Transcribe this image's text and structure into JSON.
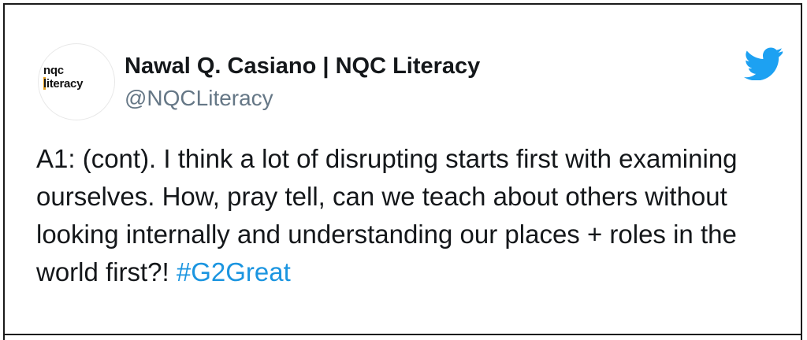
{
  "author": {
    "display_name": "Nawal Q. Casiano | NQC Literacy",
    "handle": "@NQCLiteracy",
    "avatar": {
      "line1": "nqc",
      "line2": "literacy",
      "accent_color": "#e8a01c"
    }
  },
  "tweet": {
    "text": "A1: (cont). I think a lot of disrupting starts first with examining ourselves. How, pray tell, can we teach about others without looking internally and understanding our places + roles in the world first?! ",
    "hashtag": "#G2Great"
  },
  "icons": {
    "brand": "twitter-bird-icon"
  },
  "colors": {
    "text": "#14171a",
    "handle": "#657786",
    "hashtag": "#1b95e0",
    "twitter_blue": "#1da1f2",
    "border": "#1a1a1a"
  }
}
